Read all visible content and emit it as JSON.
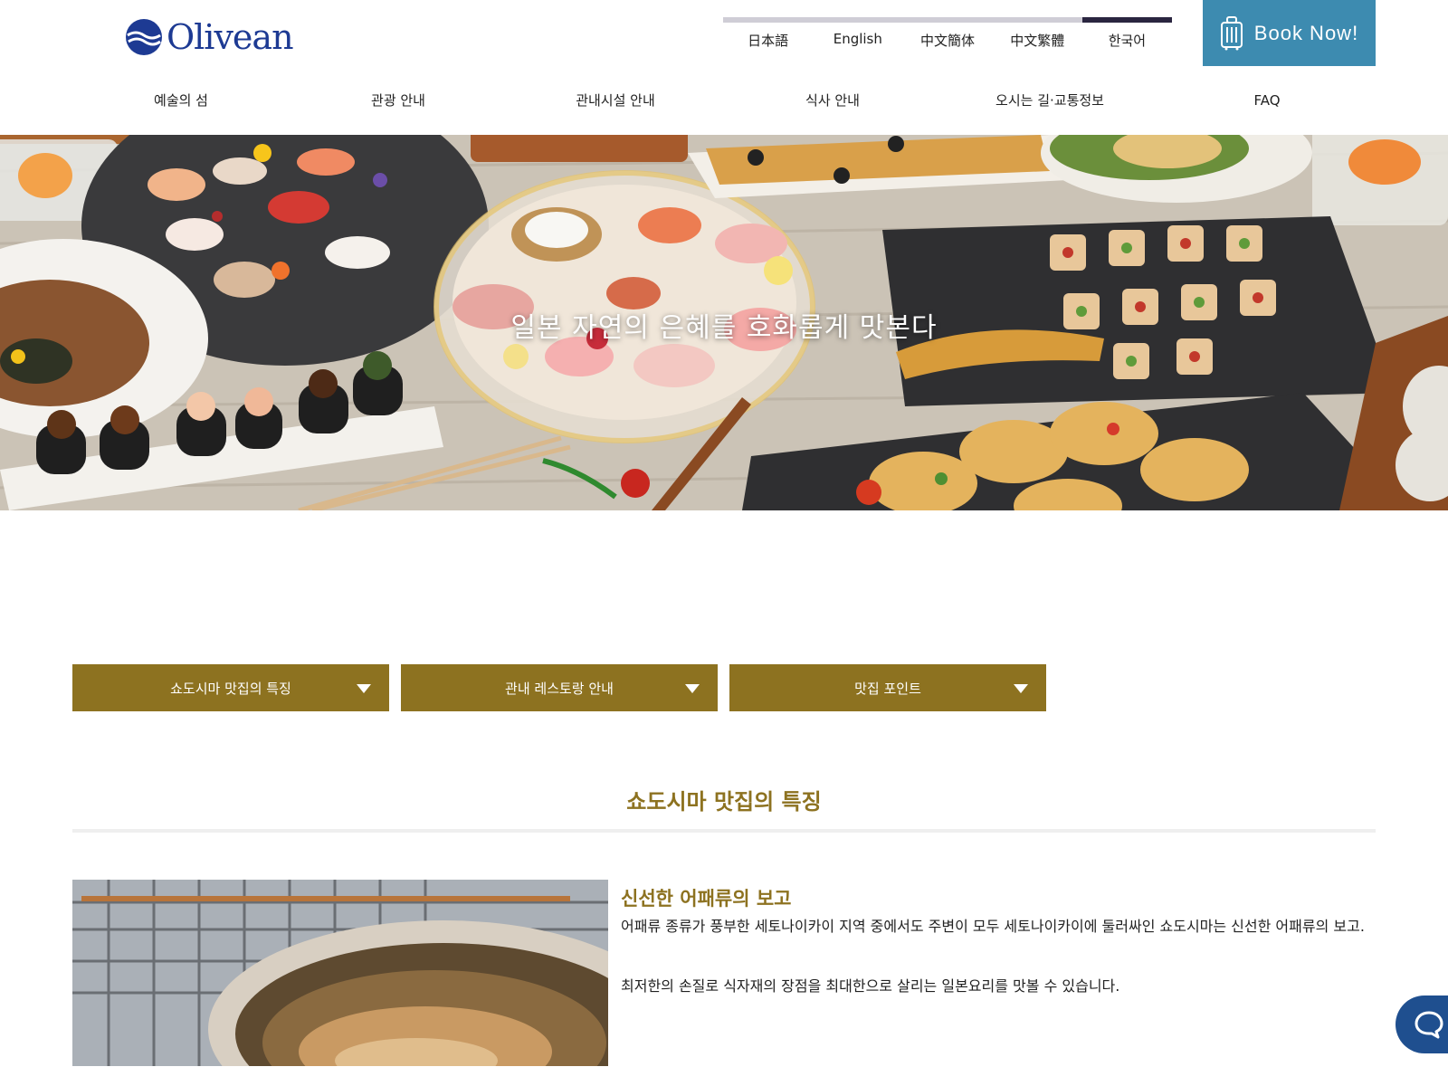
{
  "brand": {
    "logo_text": "Olivean",
    "primary_color": "#1d3a93"
  },
  "languages": {
    "items": [
      {
        "label": "日本語",
        "active": false
      },
      {
        "label": "English",
        "active": false
      },
      {
        "label": "中文簡体",
        "active": false
      },
      {
        "label": "中文繁體",
        "active": false
      },
      {
        "label": "한국어",
        "active": true
      }
    ]
  },
  "book_now": {
    "label": "Book Now!",
    "color": "#3d8bb0",
    "icon": "suitcase-icon"
  },
  "nav": {
    "items": [
      "예술의 섬",
      "관광 안내",
      "관내시설 안내",
      "식사 안내",
      "오시는 길·교통정보",
      "FAQ"
    ]
  },
  "hero": {
    "caption": "일본 자연의 은혜를 호화롭게 맛본다"
  },
  "tabs": {
    "accent": "#8d7220",
    "items": [
      "쇼도시마 맛집의 특징",
      "관내 레스토랑 안내",
      "맛집 포인트"
    ]
  },
  "section": {
    "title": "쇼도시마 맛집의 특징"
  },
  "feature": {
    "heading": "신선한 어패류의 보고",
    "paragraphs": [
      "어패류 종류가 풍부한 세토나이카이 지역 중에서도 주변이 모두 세토나이카이에 둘러싸인 쇼도시마는 신선한 어패류의 보고.",
      "최저한의 손질로 식자재의 장점을 최대한으로 살리는 일본요리를 맛볼 수 있습니다."
    ]
  },
  "chat": {
    "icon": "chat-bubble-icon"
  }
}
